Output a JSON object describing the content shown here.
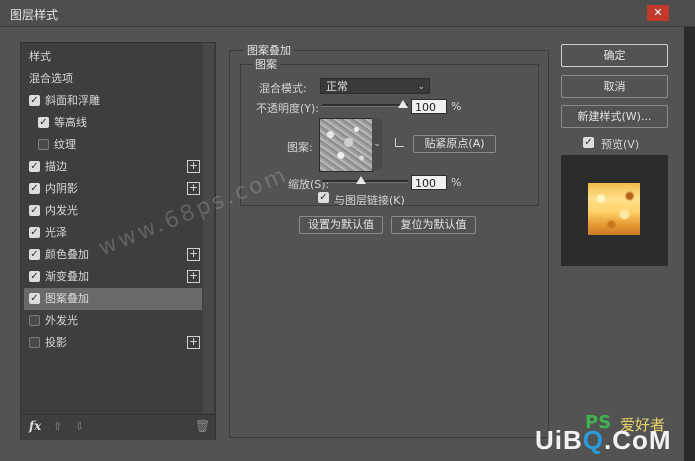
{
  "window": {
    "title": "图层样式",
    "close_label": "✕"
  },
  "style_list": {
    "items": [
      {
        "label": "样式",
        "checkbox": "none"
      },
      {
        "label": "混合选项",
        "checkbox": "none"
      },
      {
        "label": "斜面和浮雕",
        "checkbox": "on"
      },
      {
        "label": "等高线",
        "checkbox": "on"
      },
      {
        "label": "纹理",
        "checkbox": "off"
      },
      {
        "label": "描边",
        "checkbox": "on",
        "plus": "+"
      },
      {
        "label": "内阴影",
        "checkbox": "on",
        "plus": "+"
      },
      {
        "label": "内发光",
        "checkbox": "on"
      },
      {
        "label": "光泽",
        "checkbox": "on"
      },
      {
        "label": "颜色叠加",
        "checkbox": "on",
        "plus": "+"
      },
      {
        "label": "渐变叠加",
        "checkbox": "on",
        "plus": "+"
      },
      {
        "label": "图案叠加",
        "checkbox": "on",
        "selected": true
      },
      {
        "label": "外发光",
        "checkbox": "off"
      },
      {
        "label": "投影",
        "checkbox": "off",
        "plus": "+"
      }
    ],
    "footer": {
      "fx": "fx",
      "up": "⇧",
      "down": "⇩",
      "trash": "🗑"
    }
  },
  "pattern_overlay": {
    "title": "图案叠加",
    "sub_title": "图案",
    "blend_mode_label": "混合模式:",
    "blend_mode_value": "正常",
    "opacity_label": "不透明度(Y):",
    "opacity_value": "100",
    "opacity_unit": "%",
    "pattern_label": "图案:",
    "snap_origin_button": "贴紧原点(A)",
    "scale_label": "缩放(S):",
    "scale_value": "100",
    "scale_unit": "%",
    "link_label": "与图层链接(K)",
    "link_checked": true,
    "make_default_button": "设置为默认值",
    "reset_default_button": "复位为默认值"
  },
  "actions": {
    "ok": "确定",
    "cancel": "取消",
    "new_style": "新建样式(W)...",
    "preview_label": "预览(V)",
    "preview_checked": true
  },
  "watermarks": {
    "site1": "www.68ps.com",
    "ps": "PS",
    "cn": "爱好者",
    "site2_a": "UiB",
    "site2_o": "Q",
    "site2_b": ".CoM"
  },
  "colors": {
    "dialog_bg": "#535353",
    "list_bg": "#3e3e3e",
    "selected_row": "#6a6a6a",
    "close": "#c0392b"
  }
}
